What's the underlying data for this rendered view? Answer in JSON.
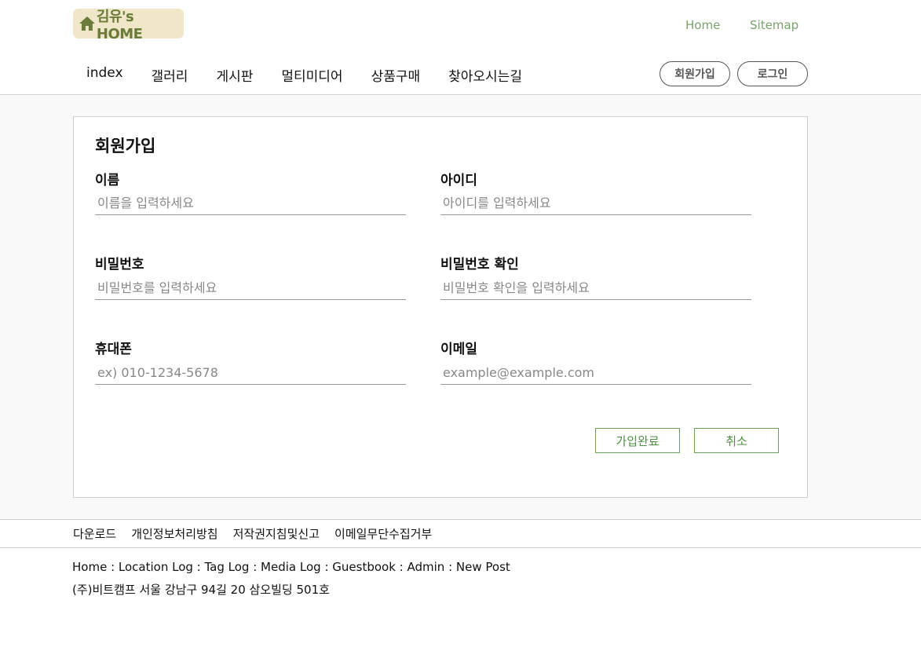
{
  "header": {
    "logo_text": "김유's HOME",
    "logo_icon": "house-icon",
    "brand_color": "#6a7b3a",
    "top_links": {
      "home": "Home",
      "sitemap": "Sitemap"
    },
    "nav": [
      "index",
      "갤러리",
      "게시판",
      "멀티미디어",
      "상품구매",
      "찾아오시는길"
    ],
    "join_label": "회원가입",
    "login_label": "로그인"
  },
  "form": {
    "title": "회원가입",
    "fields": {
      "name": {
        "label": "이름",
        "placeholder": "이름을 입력하세요",
        "value": ""
      },
      "id": {
        "label": "아이디",
        "placeholder": "아이디를 입력하세요",
        "value": ""
      },
      "password": {
        "label": "비밀번호",
        "placeholder": "비밀번호를 입력하세요",
        "value": ""
      },
      "password_confirm": {
        "label": "비밀번호 확인",
        "placeholder": "비밀번호 확인을 입력하세요",
        "value": ""
      },
      "phone": {
        "label": "휴대폰",
        "placeholder": "ex) 010-1234-5678",
        "value": ""
      },
      "email": {
        "label": "이메일",
        "placeholder": "example@example.com",
        "value": ""
      }
    },
    "submit_label": "가입완료",
    "cancel_label": "취소",
    "accent_color": "#6aa25a"
  },
  "footer": {
    "links": [
      "다운로드",
      "개인정보처리방침",
      "저작권지침및신고",
      "이메일무단수집거부"
    ],
    "nav": [
      "Home",
      "Location Log",
      "Tag Log",
      "Media Log",
      "Guestbook",
      "Admin",
      "New Post"
    ],
    "separator": " : ",
    "address": "(주)비트캠프 서울 강남구 94길 20 삼오빌딩 501호"
  }
}
